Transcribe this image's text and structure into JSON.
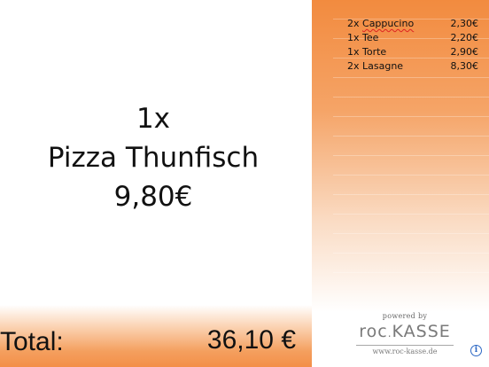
{
  "current_item": {
    "quantity": "1x",
    "name": "Pizza Thunfisch",
    "price": "9,80€"
  },
  "total": {
    "label": "Total:",
    "value": "36,10 €"
  },
  "orders": [
    {
      "desc": "2x Cappucino",
      "price": "2,30€"
    },
    {
      "desc": "1x Tee",
      "price": "2,20€"
    },
    {
      "desc": "1x Torte",
      "price": "2,90€"
    },
    {
      "desc": "2x Lasagne",
      "price": "8,30€"
    }
  ],
  "branding": {
    "powered_by": "powered by",
    "brand_main": "roc",
    "brand_dot": ".",
    "brand_tail": "KASSE",
    "url": "www.roc-kasse.de"
  },
  "info_icon": "info-icon",
  "colors": {
    "accent_orange": "#f38f48",
    "info_blue": "#2d68c4"
  }
}
